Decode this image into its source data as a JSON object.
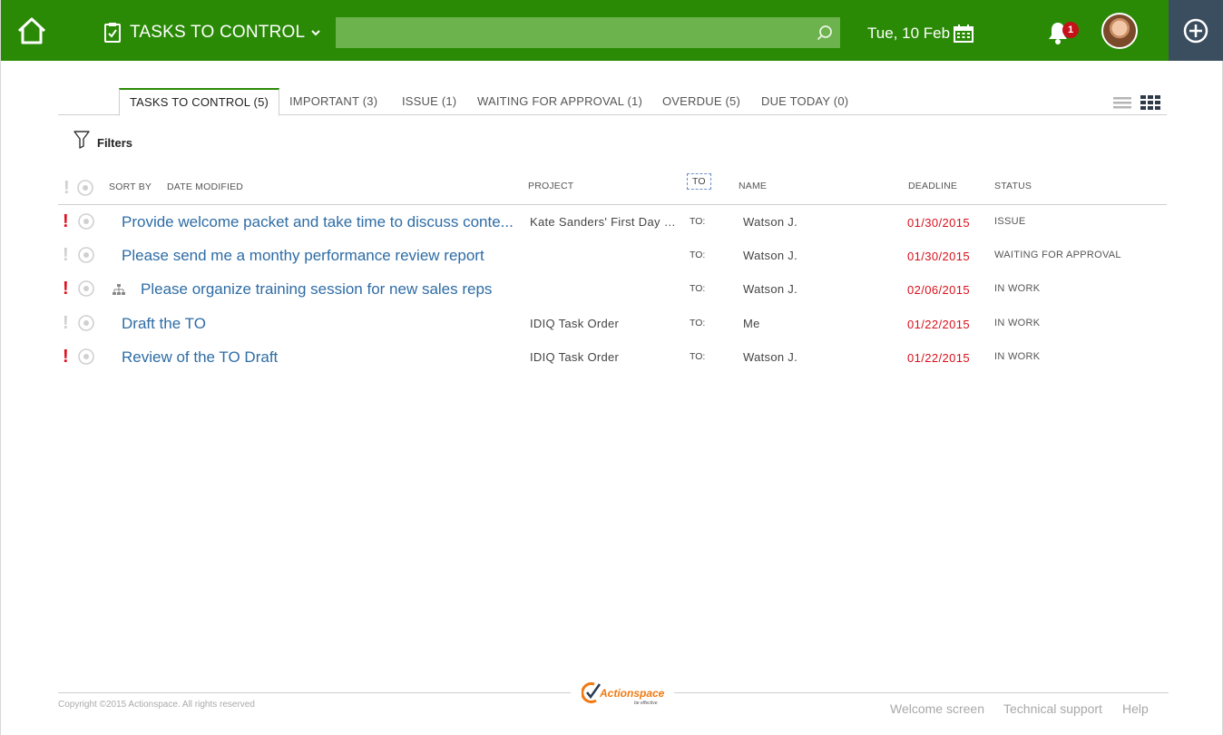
{
  "header": {
    "title": "TASKS TO CONTROL",
    "search_value": "",
    "date": "Tue, 10 Feb",
    "notification_count": "1"
  },
  "tabs": [
    {
      "label": "TASKS TO CONTROL (5)",
      "active": true
    },
    {
      "label": "IMPORTANT (3)"
    },
    {
      "label": "ISSUE (1)"
    },
    {
      "label": "WAITING FOR APPROVAL (1)"
    },
    {
      "label": "OVERDUE (5)"
    },
    {
      "label": "DUE TODAY (0)"
    }
  ],
  "filters_label": "Filters",
  "columns": {
    "sort_by": "SORT BY",
    "date_modified": "DATE MODIFIED",
    "project": "PROJECT",
    "to": "TO",
    "name": "NAME",
    "deadline": "DEADLINE",
    "status": "STATUS"
  },
  "rows": [
    {
      "important": true,
      "task": "Provide welcome packet and take time to discuss conte...",
      "project": "Kate Sanders' First Day C...",
      "to": "TO:",
      "name": "Watson J.",
      "deadline": "01/30/2015",
      "status": "ISSUE",
      "subtask": false
    },
    {
      "important": false,
      "task": "Please send me a monthy performance review report",
      "project": "",
      "to": "TO:",
      "name": "Watson J.",
      "deadline": "01/30/2015",
      "status": "WAITING FOR APPROVAL",
      "subtask": false
    },
    {
      "important": true,
      "task": "Please organize training session for new sales reps",
      "project": "",
      "to": "TO:",
      "name": "Watson J.",
      "deadline": "02/06/2015",
      "status": "IN WORK",
      "subtask": true
    },
    {
      "important": false,
      "task": "Draft the TO",
      "project": "IDIQ Task Order",
      "to": "TO:",
      "name": "Me",
      "deadline": "01/22/2015",
      "status": "IN WORK",
      "subtask": false
    },
    {
      "important": true,
      "task": "Review of the TO Draft",
      "project": "IDIQ Task Order",
      "to": "TO:",
      "name": "Watson J.",
      "deadline": "01/22/2015",
      "status": "IN WORK",
      "subtask": false
    }
  ],
  "footer": {
    "copyright": "Copyright ©2015 Actionspace. All rights reserved",
    "logo_text": "Actionspace",
    "logo_tagline": "be effective",
    "links": [
      "Welcome screen",
      "Technical support",
      "Help"
    ]
  },
  "colors": {
    "topbar": "#2a8a06",
    "search_bg": "#6cb24d",
    "add_button_bg": "#3b4e5f",
    "task_link": "#2e6ca5",
    "deadline": "#d9101b",
    "important": "#e0101d"
  },
  "icons": [
    "home-icon",
    "clipboard-check-icon",
    "chevron-down-icon",
    "search-icon",
    "calendar-icon",
    "bell-icon",
    "plus-circle-icon",
    "list-view-icon",
    "grid-view-icon",
    "filter-icon",
    "exclamation-icon",
    "circle-target-icon",
    "subtask-hierarchy-icon"
  ]
}
